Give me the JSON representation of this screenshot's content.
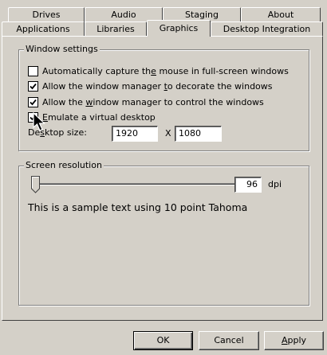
{
  "tabs_row1": [
    "Drives",
    "Audio",
    "Staging",
    "About"
  ],
  "tabs_row2": [
    "Applications",
    "Libraries",
    "Graphics",
    "Desktop Integration"
  ],
  "active_tab": "Graphics",
  "window_settings": {
    "legend": "Window settings",
    "options": [
      {
        "label_pre": "Automatically capture th",
        "label_u": "e",
        "label_post": " mouse in full-screen windows",
        "checked": false
      },
      {
        "label_pre": "Allow the window manager ",
        "label_u": "t",
        "label_post": "o decorate the windows",
        "checked": true
      },
      {
        "label_pre": "Allow the ",
        "label_u": "w",
        "label_post": "indow manager to control the windows",
        "checked": true
      },
      {
        "label_pre": "",
        "label_u": "E",
        "label_post": "mulate a virtual desktop",
        "checked": true
      }
    ],
    "desktop_size_pre": "De",
    "desktop_size_u": "s",
    "desktop_size_post": "ktop size:",
    "width": "1920",
    "separator": "X",
    "height": "1080"
  },
  "screen_resolution": {
    "legend": "Screen resolution",
    "dpi_value": "96",
    "dpi_unit": "dpi",
    "slider_level": 0.0,
    "sample_text": "This is a sample text using 10 point Tahoma"
  },
  "buttons": {
    "ok": "OK",
    "cancel": "Cancel",
    "apply_u": "A",
    "apply_post": "pply"
  }
}
